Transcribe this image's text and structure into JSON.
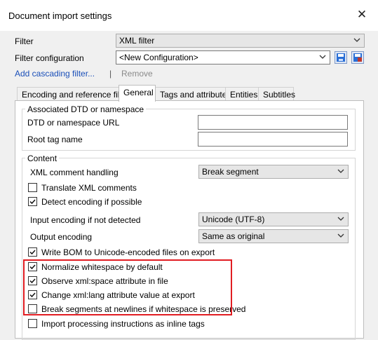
{
  "window": {
    "title": "Document import settings",
    "close_glyph": "✕"
  },
  "filter": {
    "label": "Filter",
    "value": "XML filter",
    "config_label": "Filter configuration",
    "config_value": "<New Configuration>"
  },
  "actions": {
    "add_cascading": "Add cascading filter...",
    "separator": "|",
    "remove": "Remove"
  },
  "tabs": [
    "Encoding and reference files",
    "General",
    "Tags and attributes",
    "Entities",
    "Subtitles"
  ],
  "active_tab": "General",
  "dtd_group": {
    "title": "Associated DTD or namespace",
    "dtd_label": "DTD or namespace URL",
    "dtd_value": "",
    "root_label": "Root tag name",
    "root_value": ""
  },
  "content": {
    "title": "Content",
    "xml_comment_label": "XML comment handling",
    "xml_comment_value": "Break segment",
    "translate_comments": {
      "label": "Translate XML comments",
      "checked": false
    },
    "detect_encoding": {
      "label": "Detect encoding if possible",
      "checked": true
    },
    "input_encoding_label": "Input encoding if not detected",
    "input_encoding_value": "Unicode (UTF-8)",
    "output_encoding_label": "Output encoding",
    "output_encoding_value": "Same as original",
    "write_bom": {
      "label": "Write BOM to Unicode-encoded files on export",
      "checked": true
    },
    "normalize_whitespace": {
      "label": "Normalize whitespace by default",
      "checked": true
    },
    "observe_xml_space": {
      "label": "Observe xml:space attribute in file",
      "checked": true
    },
    "change_xml_lang": {
      "label": "Change xml:lang attribute value at export",
      "checked": true
    },
    "break_newlines": {
      "label": "Break segments at newlines if whitespace is preserved",
      "checked": false
    },
    "import_pi": {
      "label": "Import processing instructions as inline tags",
      "checked": false
    }
  },
  "colors": {
    "highlight": "#e11d22",
    "link": "#1a4fb8",
    "save_icon": "#2a6fd6",
    "save_as_icon": "#c0392b"
  }
}
